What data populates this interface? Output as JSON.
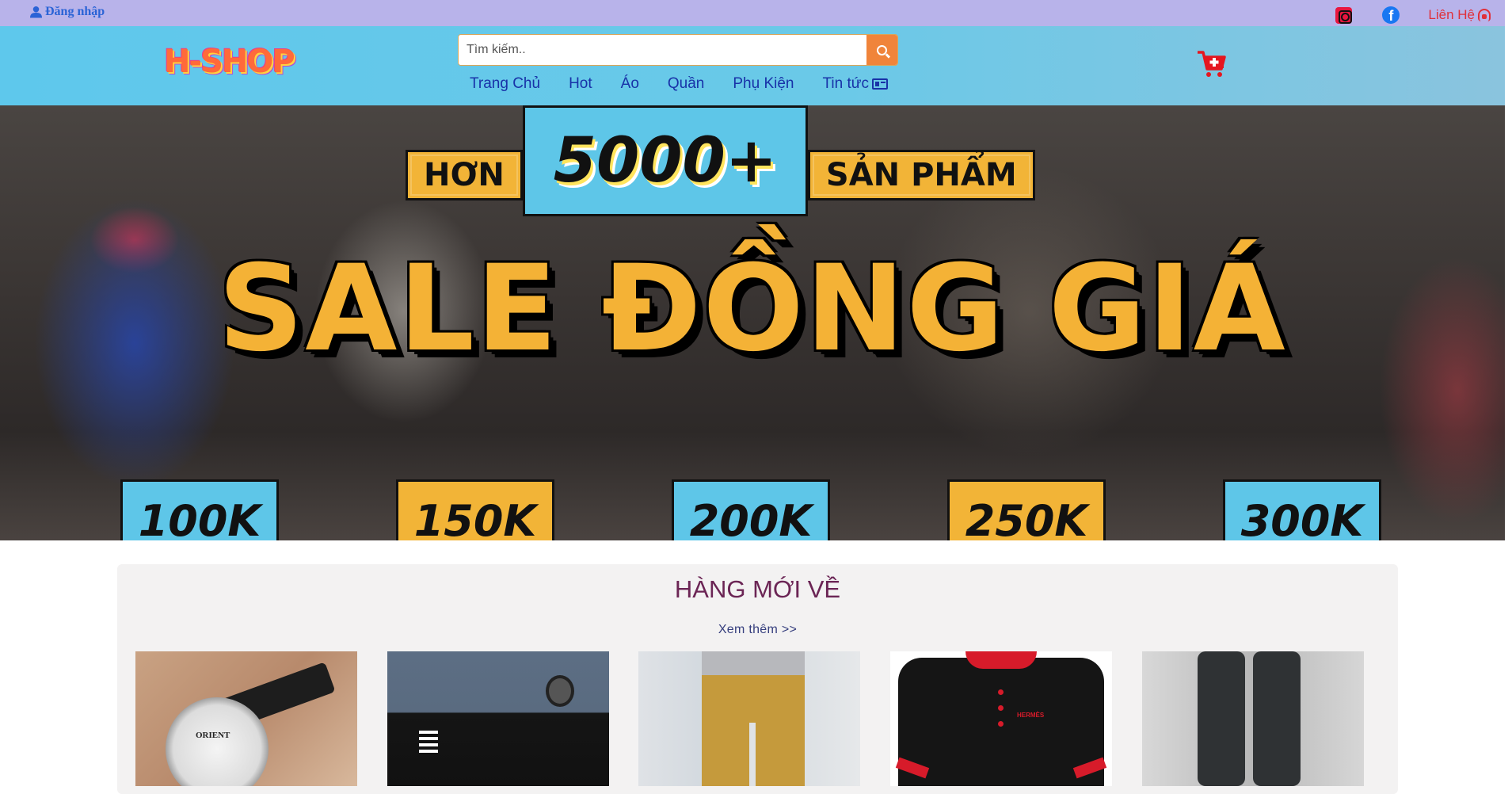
{
  "topbar": {
    "login_label": "Đăng nhập",
    "contact_label": "Liên Hệ",
    "icons": [
      "user-icon",
      "instagram-icon",
      "facebook-icon",
      "headset-icon"
    ]
  },
  "header": {
    "logo_text": "H-SHOP",
    "search": {
      "placeholder": "Tìm kiếm..",
      "value": ""
    },
    "nav": [
      {
        "label": "Trang Chủ"
      },
      {
        "label": "Hot"
      },
      {
        "label": "Áo"
      },
      {
        "label": "Quần"
      },
      {
        "label": "Phụ Kiện"
      },
      {
        "label": "Tin tức"
      }
    ],
    "cart_icon": "cart-plus-icon"
  },
  "banner": {
    "top_left": "HƠN",
    "count": "5000+",
    "top_right": "SẢN PHẨM",
    "title": "SALE ĐỒNG GIÁ",
    "prices": [
      "100K",
      "150K",
      "200K",
      "250K",
      "300K"
    ]
  },
  "new_arrivals": {
    "title": "HÀNG MỚI VỀ",
    "see_more": "Xem thêm >>",
    "watch_brand": "ORIENT",
    "shirt_brand": "HERMÈS"
  },
  "colors": {
    "topbar_bg": "#b8b3ea",
    "header_bg": "#5ec8ec",
    "nav_text": "#1832a8",
    "search_button": "#f0843a",
    "banner_yellow": "#f2b437",
    "banner_blue": "#5ec6e8",
    "section_title": "#6b2555",
    "cart": "#e5161f"
  }
}
